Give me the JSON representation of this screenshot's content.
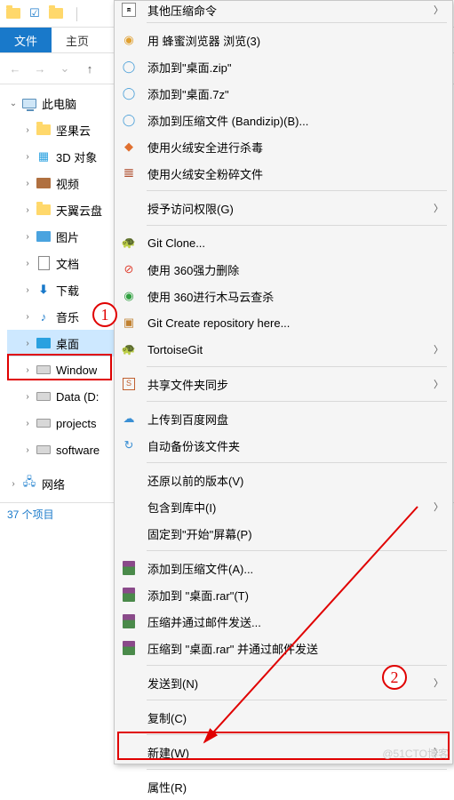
{
  "titlebar": {
    "icons": [
      "explorer",
      "check",
      "folder",
      "divider"
    ]
  },
  "tabs": {
    "file": "文件",
    "home": "主页"
  },
  "tree": {
    "root": "此电脑",
    "children": [
      {
        "label": "坚果云",
        "icon": "folder-y"
      },
      {
        "label": "3D 对象",
        "icon": "cube3d"
      },
      {
        "label": "视频",
        "icon": "video"
      },
      {
        "label": "天翼云盘",
        "icon": "folder-y"
      },
      {
        "label": "图片",
        "icon": "picture"
      },
      {
        "label": "文档",
        "icon": "doc"
      },
      {
        "label": "下载",
        "icon": "download"
      },
      {
        "label": "音乐",
        "icon": "music"
      },
      {
        "label": "桌面",
        "icon": "desktop",
        "selected": true
      },
      {
        "label": "Window",
        "icon": "disk"
      },
      {
        "label": "Data (D:",
        "icon": "disk"
      },
      {
        "label": "projects",
        "icon": "disk"
      },
      {
        "label": "software",
        "icon": "disk"
      }
    ],
    "network": "网络"
  },
  "status": "37 个项目",
  "annotations": {
    "badge1": "1",
    "badge2": "2"
  },
  "watermark": "@51CTO博客",
  "menu": [
    {
      "type": "item",
      "label": "其他压缩命令",
      "icon": "archive",
      "sub": true,
      "partial": true
    },
    {
      "type": "sep"
    },
    {
      "type": "item",
      "label": "用 蜂蜜浏览器 浏览(3)",
      "icon": "honey"
    },
    {
      "type": "item",
      "label": "添加到\"桌面.zip\"",
      "icon": "bandizip"
    },
    {
      "type": "item",
      "label": "添加到\"桌面.7z\"",
      "icon": "bandizip"
    },
    {
      "type": "item",
      "label": "添加到压缩文件 (Bandizip)(B)...",
      "icon": "bandizip"
    },
    {
      "type": "item",
      "label": "使用火绒安全进行杀毒",
      "icon": "huorong"
    },
    {
      "type": "item",
      "label": "使用火绒安全粉碎文件",
      "icon": "huorong-shred"
    },
    {
      "type": "sep"
    },
    {
      "type": "item",
      "label": "授予访问权限(G)",
      "icon": "",
      "sub": true
    },
    {
      "type": "sep"
    },
    {
      "type": "item",
      "label": "Git Clone...",
      "icon": "tortoise"
    },
    {
      "type": "item",
      "label": "使用 360强力删除",
      "icon": "360del"
    },
    {
      "type": "item",
      "label": "使用 360进行木马云查杀",
      "icon": "360scan"
    },
    {
      "type": "item",
      "label": "Git Create repository here...",
      "icon": "tortoise-repo"
    },
    {
      "type": "item",
      "label": "TortoiseGit",
      "icon": "tortoise",
      "sub": true
    },
    {
      "type": "sep"
    },
    {
      "type": "item",
      "label": "共享文件夹同步",
      "icon": "share",
      "sub": true
    },
    {
      "type": "sep"
    },
    {
      "type": "item",
      "label": "上传到百度网盘",
      "icon": "baidu"
    },
    {
      "type": "item",
      "label": "自动备份该文件夹",
      "icon": "baidu-sync"
    },
    {
      "type": "sep"
    },
    {
      "type": "item",
      "label": "还原以前的版本(V)",
      "icon": ""
    },
    {
      "type": "item",
      "label": "包含到库中(I)",
      "icon": "",
      "sub": true
    },
    {
      "type": "item",
      "label": "固定到\"开始\"屏幕(P)",
      "icon": ""
    },
    {
      "type": "sep"
    },
    {
      "type": "item",
      "label": "添加到压缩文件(A)...",
      "icon": "rar"
    },
    {
      "type": "item",
      "label": "添加到 \"桌面.rar\"(T)",
      "icon": "rar"
    },
    {
      "type": "item",
      "label": "压缩并通过邮件发送...",
      "icon": "rar"
    },
    {
      "type": "item",
      "label": "压缩到 \"桌面.rar\" 并通过邮件发送",
      "icon": "rar"
    },
    {
      "type": "sep"
    },
    {
      "type": "item",
      "label": "发送到(N)",
      "icon": "",
      "sub": true
    },
    {
      "type": "sep"
    },
    {
      "type": "item",
      "label": "复制(C)",
      "icon": ""
    },
    {
      "type": "sep"
    },
    {
      "type": "item",
      "label": "新建(W)",
      "icon": "",
      "sub": true
    },
    {
      "type": "sep"
    },
    {
      "type": "item",
      "label": "属性(R)",
      "icon": ""
    }
  ]
}
